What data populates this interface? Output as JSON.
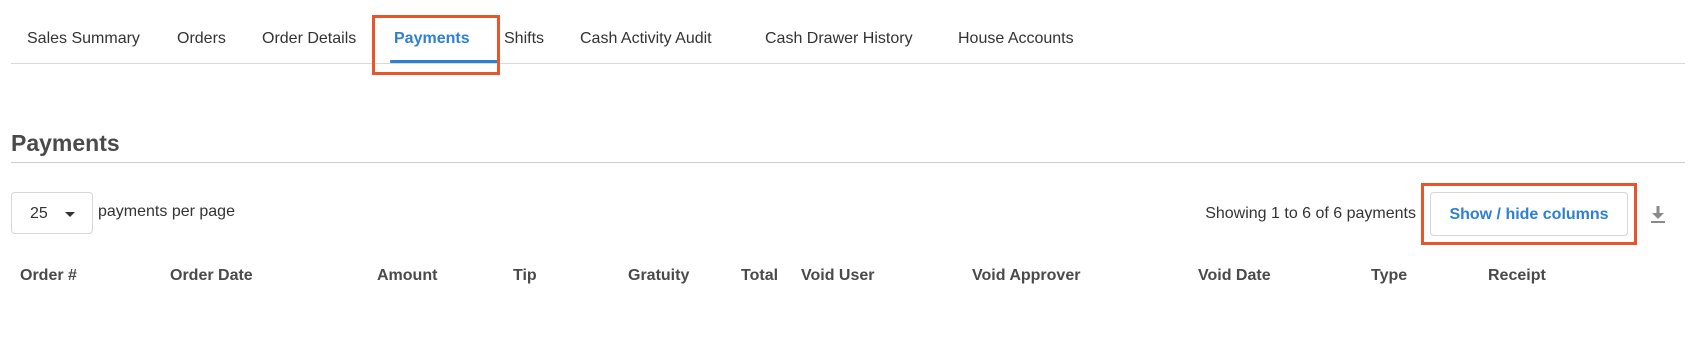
{
  "tabs": [
    {
      "label": "Sales Summary",
      "active": false
    },
    {
      "label": "Orders",
      "active": false
    },
    {
      "label": "Order Details",
      "active": false
    },
    {
      "label": "Payments",
      "active": true
    },
    {
      "label": "Shifts",
      "active": false
    },
    {
      "label": "Cash Activity Audit",
      "active": false
    },
    {
      "label": "Cash Drawer History",
      "active": false
    },
    {
      "label": "House Accounts",
      "active": false
    }
  ],
  "section": {
    "title": "Payments"
  },
  "controls": {
    "per_page_value": "25",
    "per_page_label": "payments per page",
    "showing_text": "Showing 1 to 6 of 6 payments",
    "columns_button": "Show / hide columns",
    "download_icon": "download-icon"
  },
  "table": {
    "headers": [
      "Order #",
      "Order Date",
      "Amount",
      "Tip",
      "Gratuity",
      "Total",
      "Void User",
      "Void Approver",
      "Void Date",
      "Type",
      "Receipt"
    ]
  },
  "colors": {
    "accent": "#2f80d1",
    "highlight": "#e8552a"
  }
}
